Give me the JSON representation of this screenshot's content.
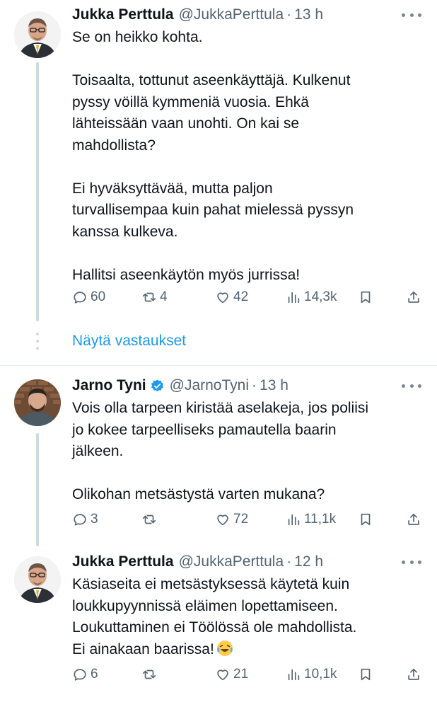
{
  "tweets": [
    {
      "name": "Jukka Perttula",
      "handle": "@JukkaPerttula",
      "dot": "·",
      "time": "13 h",
      "lines": [
        "Se on heikko kohta.",
        "",
        "Toisaalta, tottunut aseenkäyttäjä. Kulkenut",
        "pyssy vöillä kymmeniä vuosia. Ehkä",
        "lähteissään vaan unohti. On kai se",
        "mahdollista?",
        "",
        "Ei hyväksyttävää, mutta paljon",
        "turvallisempaa kuin pahat mielessä pyssyn",
        "kanssa kulkeva.",
        "",
        "Hallitsi aseenkäytön myös jurrissa!"
      ],
      "replies": "60",
      "reposts": "4",
      "likes": "42",
      "views": "14,3k"
    },
    {
      "name": "Jarno Tyni",
      "handle": "@JarnoTyni",
      "dot": "·",
      "time": "13 h",
      "verified": true,
      "lines": [
        "Vois olla tarpeen kiristää aselakeja, jos poliisi",
        "jo kokee tarpeelliseks pamautella baarin",
        "jälkeen.",
        "",
        "Olikohan metsästystä varten mukana?"
      ],
      "replies": "3",
      "reposts": "",
      "likes": "72",
      "views": "11,1k"
    },
    {
      "name": "Jukka Perttula",
      "handle": "@JukkaPerttula",
      "dot": "·",
      "time": "12 h",
      "lines": [
        "Käsiaseita ei metsästyksessä käytetä kuin",
        "loukkupyynnissä eläimen lopettamiseen.",
        "Loukuttaminen ei Töölössä ole mahdollista.",
        "Ei ainakaan baarissa!"
      ],
      "replies": "6",
      "reposts": "",
      "likes": "21",
      "views": "10,1k"
    }
  ],
  "show_replies": "Näytä vastaukset",
  "icons": {
    "reply": "reply-icon",
    "repost": "repost-icon",
    "like": "heart-icon",
    "views": "views-icon",
    "bookmark": "bookmark-icon",
    "share": "share-icon",
    "emoji": "laughing-tears-emoji"
  },
  "colors": {
    "link": "#1d9bf0",
    "muted": "#536471",
    "thread": "#cfd9de",
    "verified": "#1d9bf0"
  }
}
